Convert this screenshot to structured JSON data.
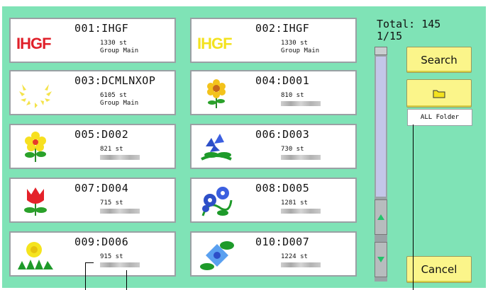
{
  "header": {
    "total_label": "Total: 145",
    "page_label": "1/15"
  },
  "buttons": {
    "search_label": "Search",
    "folder_label": "ALL Folder",
    "cancel_label": "Cancel"
  },
  "designs": [
    {
      "name": "001:IHGF",
      "stitches": "1330 st",
      "group": "Group Main",
      "thumb": "hgf-red-logo"
    },
    {
      "name": "002:IHGF",
      "stitches": "1330 st",
      "group": "Group Main",
      "thumb": "hgf-yellow-logo"
    },
    {
      "name": "003:DCMLNXOP",
      "stitches": "6105 st",
      "group": "Group Main",
      "thumb": "sun-ring"
    },
    {
      "name": "004:D001",
      "stitches": "810 st",
      "group": "",
      "thumb": "sunflower"
    },
    {
      "name": "005:D002",
      "stitches": "821 st",
      "group": "",
      "thumb": "yellow-flower"
    },
    {
      "name": "006:D003",
      "stitches": "730 st",
      "group": "",
      "thumb": "blue-bellflower"
    },
    {
      "name": "007:D004",
      "stitches": "715 st",
      "group": "",
      "thumb": "red-tulip"
    },
    {
      "name": "008:D005",
      "stitches": "1281 st",
      "group": "",
      "thumb": "morning-glory"
    },
    {
      "name": "009:D006",
      "stitches": "915 st",
      "group": "",
      "thumb": "dandelion"
    },
    {
      "name": "010:D007",
      "stitches": "1224 st",
      "group": "",
      "thumb": "hydrangea"
    }
  ],
  "colors": {
    "panel": "#7fe3b6",
    "button": "#fbf58a",
    "scroll_arrow": "#22c46a",
    "scroll_thumb": "#c3c6e9"
  }
}
